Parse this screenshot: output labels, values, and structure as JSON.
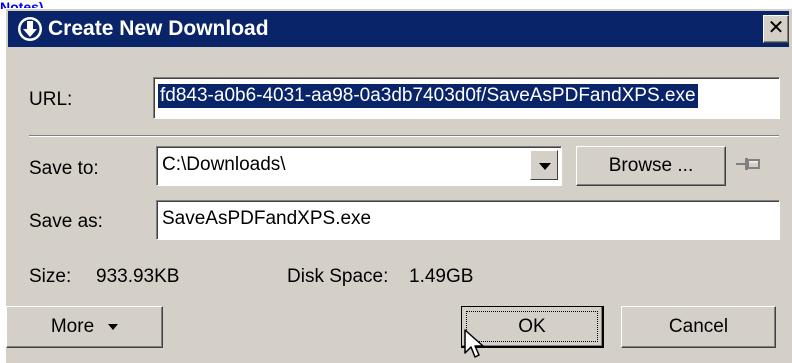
{
  "background_link": "Notes)",
  "dialog": {
    "title": "Create New Download",
    "close_glyph": "✕",
    "url_label": "URL:",
    "url_value": "fd843-a0b6-4031-aa98-0a3db7403d0f/SaveAsPDFandXPS.exe",
    "save_to_label": "Save to:",
    "save_to_value": "C:\\Downloads\\",
    "browse_label": "Browse ...",
    "save_as_label": "Save as:",
    "save_as_value": "SaveAsPDFandXPS.exe",
    "size_label": "Size:",
    "size_value": "933.93KB",
    "disk_label": "Disk Space:",
    "disk_value": "1.49GB",
    "more_label": "More",
    "ok_label": "OK",
    "cancel_label": "Cancel"
  },
  "icons": {
    "title": "download-circle-icon",
    "close": "close-icon",
    "dropdown": "chevron-down-icon",
    "pin": "pin-icon",
    "cursor": "mouse-pointer-icon"
  },
  "colors": {
    "titlebar": "#0a246a",
    "dialog_face": "#d4d0c8",
    "selection": "#0a246a"
  }
}
